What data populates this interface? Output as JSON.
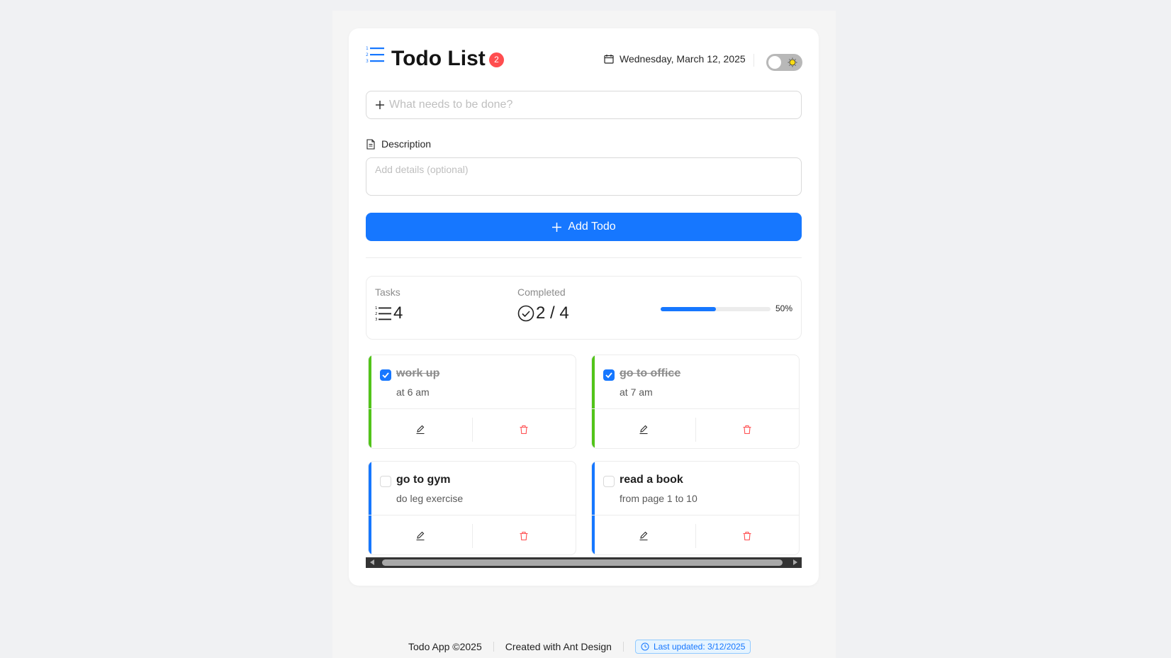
{
  "header": {
    "title": "Todo List",
    "pending_badge": "2",
    "date": "Wednesday, March 12, 2025"
  },
  "form": {
    "todo_placeholder": "What needs to be done?",
    "todo_value": "",
    "description_label": "Description",
    "description_placeholder": "Add details (optional)",
    "description_value": "",
    "add_button_label": "Add Todo"
  },
  "stats": {
    "tasks_label": "Tasks",
    "tasks_value": "4",
    "completed_label": "Completed",
    "completed_value": "2 / 4",
    "progress_percent": 50,
    "progress_text": "50%"
  },
  "todos": [
    {
      "title": "work up",
      "description": "at 6 am",
      "completed": true
    },
    {
      "title": "go to office",
      "description": "at 7 am",
      "completed": true
    },
    {
      "title": "go to gym",
      "description": "do leg exercise",
      "completed": false
    },
    {
      "title": "read a book",
      "description": "from page 1 to 10",
      "completed": false
    }
  ],
  "footer": {
    "copyright": "Todo App ©2025",
    "created_with": "Created with Ant Design",
    "last_updated": "Last updated: 3/12/2025"
  },
  "colors": {
    "primary": "#1677ff",
    "success": "#52c41a",
    "danger": "#ff4d4f"
  },
  "icons": {
    "title": "ordered-list-icon",
    "date": "calendar-icon",
    "theme": "sun-icon",
    "add": "plus-icon",
    "description": "file-text-icon",
    "edit": "edit-icon",
    "delete": "delete-icon",
    "clock": "clock-icon"
  }
}
